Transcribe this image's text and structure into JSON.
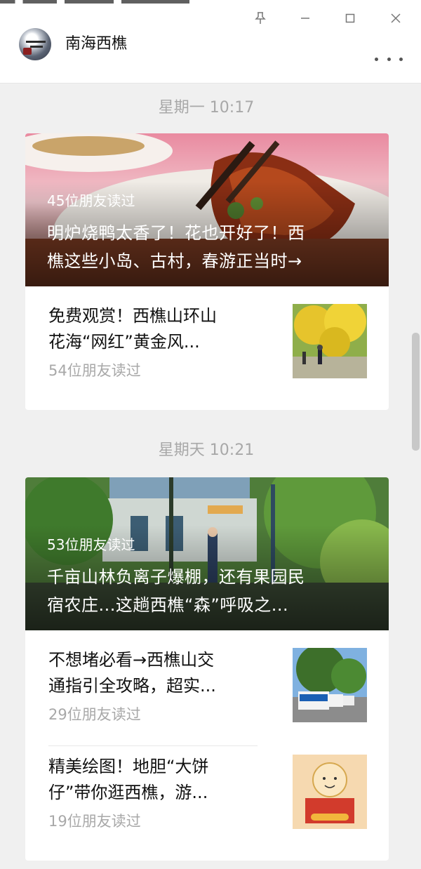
{
  "window": {
    "account_name": "南海西樵"
  },
  "feed": [
    {
      "time": "星期一 10:17",
      "hero": {
        "readers": "45位朋友读过",
        "title_line1": "明炉烧鸭太香了！花也开好了！西",
        "title_line2": "樵这些小岛、古村，春游正当时→"
      },
      "items": [
        {
          "title_line1": "免费观赏！西樵山环山",
          "title_line2": "花海“网红”黄金风...",
          "readers": "54位朋友读过"
        }
      ]
    },
    {
      "time": "星期天 10:21",
      "hero": {
        "readers": "53位朋友读过",
        "title_line1": "千亩山林负离子爆棚，还有果园民",
        "title_line2": "宿农庄...这趟西樵“森”呼吸之..."
      },
      "items": [
        {
          "title_line1": "不想堵必看→西樵山交",
          "title_line2": "通指引全攻略，超实...",
          "readers": "29位朋友读过"
        },
        {
          "title_line1": "精美绘图！地胆“大饼",
          "title_line2": "仔”带你逛西樵，游...",
          "readers": "19位朋友读过"
        }
      ]
    }
  ]
}
